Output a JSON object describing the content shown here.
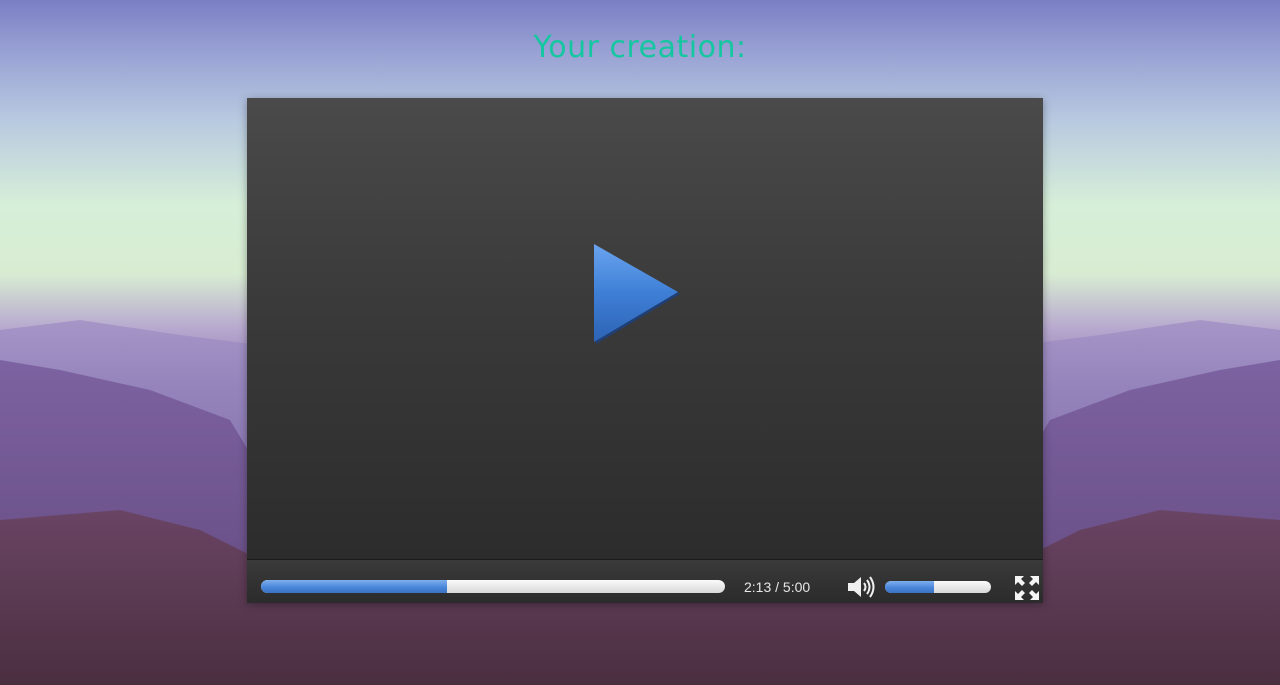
{
  "page": {
    "title": "Your creation:"
  },
  "player": {
    "current_time": "2:13",
    "duration": "5:00",
    "time_display": "2:13 / 5:00",
    "progress_fraction": 0.4,
    "volume_fraction": 0.46
  },
  "icons": {
    "big_play": "play-icon",
    "volume": "volume-icon",
    "fullscreen": "fullscreen-icon"
  },
  "colors": {
    "title": "#15c7a0",
    "accent": "#4a86d9",
    "player_bg": "#2c2c2c"
  }
}
